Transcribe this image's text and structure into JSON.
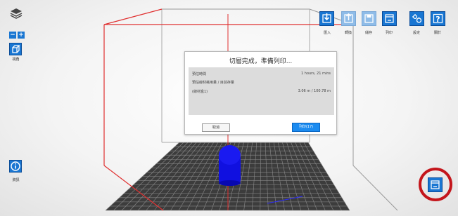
{
  "left_toolbar": {
    "view_label": "視角",
    "info_label": "資訊",
    "zoom_out": "−",
    "zoom_in": "+"
  },
  "top_toolbar": {
    "buttons": [
      {
        "label": "匯入",
        "icon": "import-icon",
        "enabled": true
      },
      {
        "label": "轉換",
        "icon": "export-icon",
        "enabled": false
      },
      {
        "label": "儲存",
        "icon": "save-icon",
        "enabled": false
      },
      {
        "label": "列印",
        "icon": "print-icon",
        "enabled": true
      },
      {
        "label": "設定",
        "icon": "settings-icon",
        "enabled": true
      },
      {
        "label": "關於",
        "icon": "help-icon",
        "enabled": true
      }
    ]
  },
  "dialog": {
    "title": "切層完成，準備列印...",
    "rows": [
      {
        "label": "預估時間",
        "value": "1 hours, 21 mins"
      },
      {
        "label": "預估線材耗用量 / 目前存量",
        "value": ""
      },
      {
        "label": "(線材盒1)",
        "value": "3.06 m / 100.78 m"
      }
    ],
    "cancel_label": "取消",
    "print_label": "列印(17)"
  },
  "colors": {
    "accent": "#1976d2",
    "box_edge_red": "#e03030",
    "model": "#1010e0",
    "highlight_ring": "#c4161c"
  }
}
